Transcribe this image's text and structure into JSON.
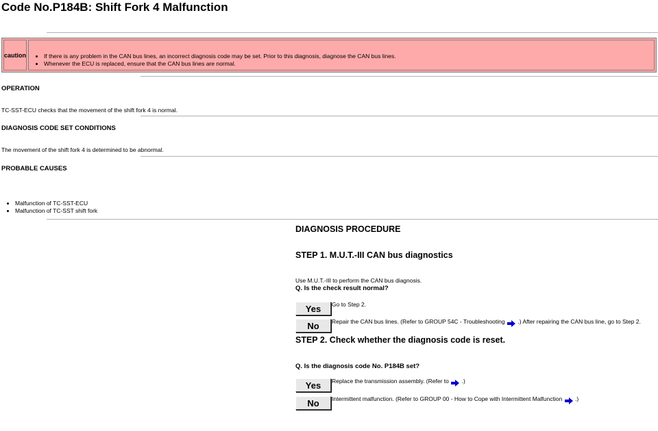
{
  "title": "Code No.P184B: Shift Fork 4 Malfunction",
  "caution": {
    "label": "caution",
    "items": [
      "If there is any problem in the CAN bus lines, an incorrect diagnosis code may be set. Prior to this diagnosis, diagnose the CAN bus lines.",
      "Whenever the ECU is replaced, ensure that the CAN bus lines are normal."
    ]
  },
  "operation": {
    "heading": "OPERATION",
    "text": "TC-SST-ECU checks that the movement of the shift fork 4 is normal."
  },
  "conditions": {
    "heading": "DIAGNOSIS CODE SET CONDITIONS",
    "text": "The movement of the shift fork 4 is determined to be abnormal."
  },
  "causes": {
    "heading": "PROBABLE CAUSES",
    "items": [
      "Malfunction of TC-SST-ECU",
      "Malfunction of TC-SST shift fork"
    ]
  },
  "procedure": {
    "heading": "DIAGNOSIS PROCEDURE",
    "step1": {
      "title": "STEP 1. M.U.T.-III CAN bus diagnostics",
      "instruction": "Use M.U.T.-III to perform the CAN bus diagnosis.",
      "question": "Q. Is the check result normal?",
      "yes_label": "Yes",
      "yes_text": "Go to Step 2.",
      "no_label": "No",
      "no_text_a": "Repair the CAN bus lines. (Refer to GROUP 54C - Troubleshooting",
      "no_text_b": ".) After repairing the CAN bus line, go to Step 2."
    },
    "step2": {
      "title": "STEP 2. Check whether the diagnosis code is reset.",
      "question": "Q. Is the diagnosis code No. P184B set?",
      "yes_label": "Yes",
      "yes_text_a": "Replace the transmission assembly. (Refer to",
      "yes_text_b": ".)",
      "no_label": "No",
      "no_text_a": "Intermittent malfunction. (Refer to GROUP 00 - How to Cope with Intermittent Malfunction",
      "no_text_b": ".)"
    }
  },
  "colors": {
    "caution_bg": "#ffaaaa",
    "link_arrow": "#0000cc"
  }
}
